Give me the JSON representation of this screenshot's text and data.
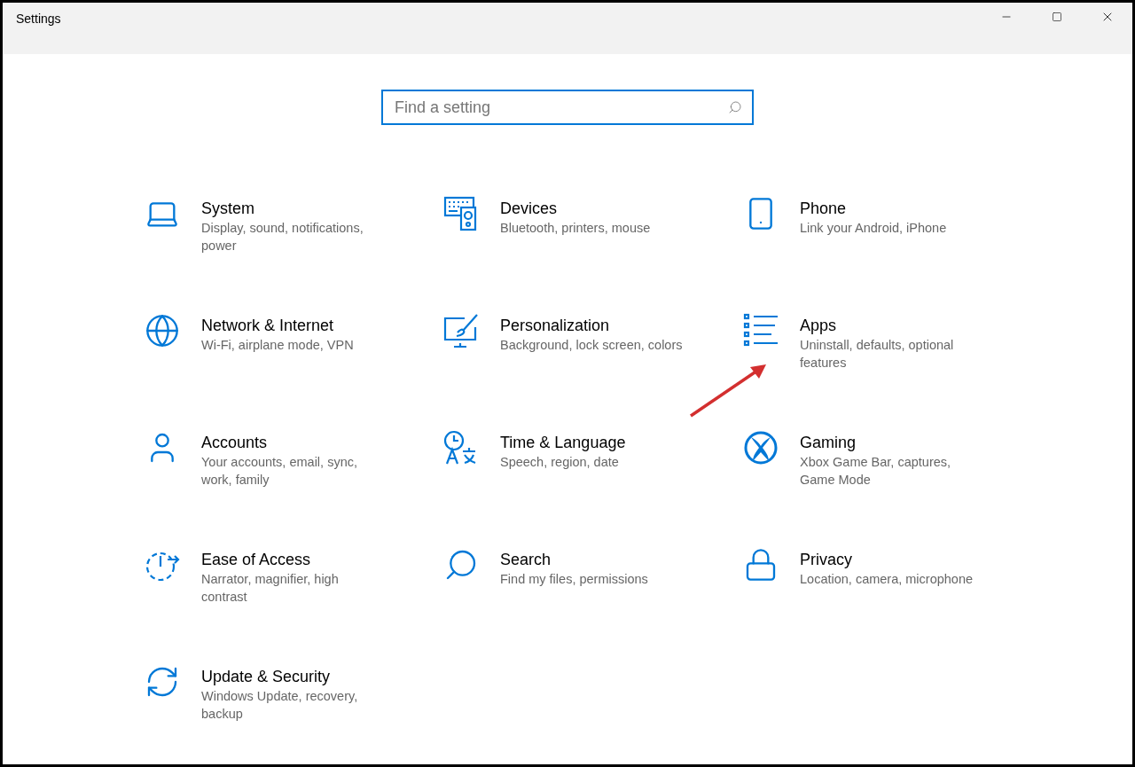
{
  "window": {
    "title": "Settings"
  },
  "search": {
    "placeholder": "Find a setting"
  },
  "categories": [
    {
      "title": "System",
      "description": "Display, sound, notifications, power"
    },
    {
      "title": "Devices",
      "description": "Bluetooth, printers, mouse"
    },
    {
      "title": "Phone",
      "description": "Link your Android, iPhone"
    },
    {
      "title": "Network & Internet",
      "description": "Wi-Fi, airplane mode, VPN"
    },
    {
      "title": "Personalization",
      "description": "Background, lock screen, colors"
    },
    {
      "title": "Apps",
      "description": "Uninstall, defaults, optional features"
    },
    {
      "title": "Accounts",
      "description": "Your accounts, email, sync, work, family"
    },
    {
      "title": "Time & Language",
      "description": "Speech, region, date"
    },
    {
      "title": "Gaming",
      "description": "Xbox Game Bar, captures, Game Mode"
    },
    {
      "title": "Ease of Access",
      "description": "Narrator, magnifier, high contrast"
    },
    {
      "title": "Search",
      "description": "Find my files, permissions"
    },
    {
      "title": "Privacy",
      "description": "Location, camera, microphone"
    },
    {
      "title": "Update & Security",
      "description": "Windows Update, recovery, backup"
    }
  ]
}
